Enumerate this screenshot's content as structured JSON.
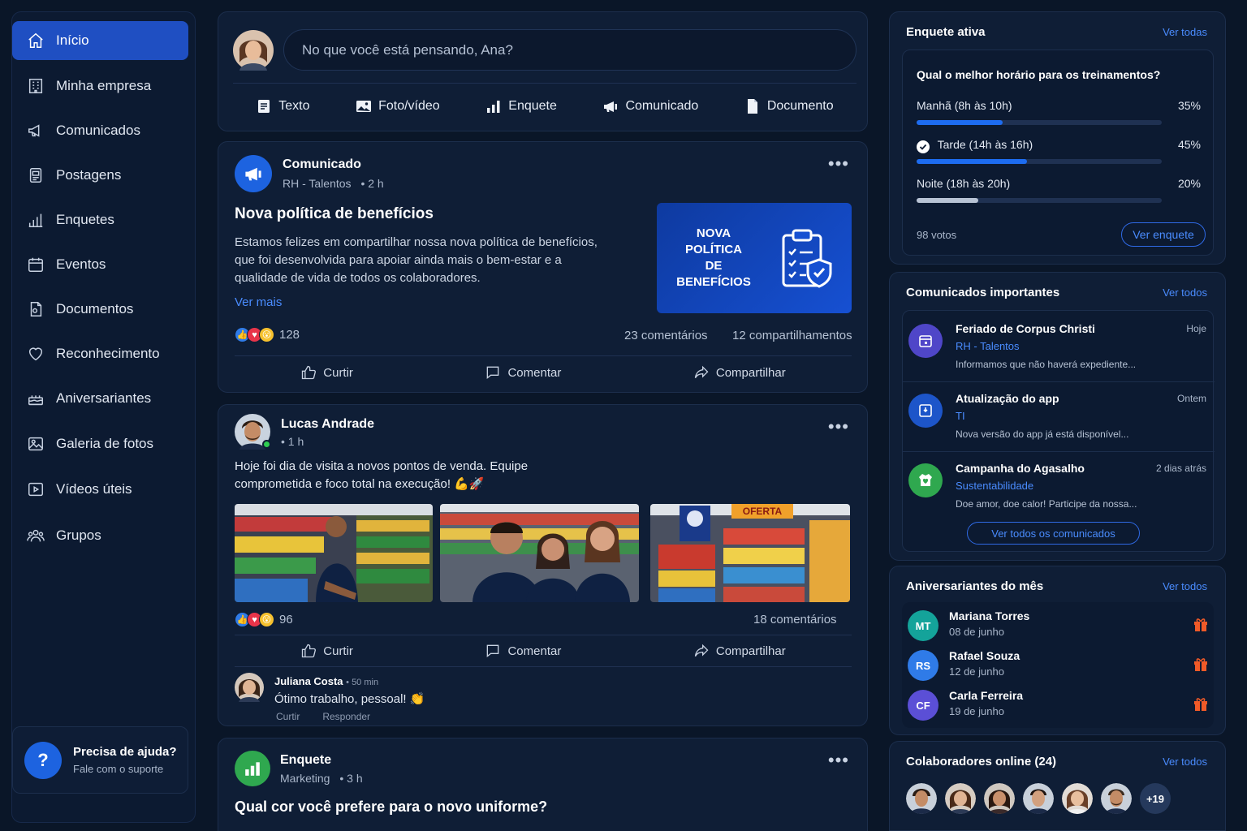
{
  "sidebar": {
    "items": [
      {
        "label": "Início",
        "icon": "home-icon",
        "active": true
      },
      {
        "label": "Minha empresa",
        "icon": "building-icon"
      },
      {
        "label": "Comunicados",
        "icon": "megaphone-icon"
      },
      {
        "label": "Postagens",
        "icon": "post-icon"
      },
      {
        "label": "Enquetes",
        "icon": "poll-icon"
      },
      {
        "label": "Eventos",
        "icon": "calendar-icon"
      },
      {
        "label": "Documentos",
        "icon": "document-icon"
      },
      {
        "label": "Reconhecimento",
        "icon": "heart-icon"
      },
      {
        "label": "Aniversariantes",
        "icon": "cake-icon"
      },
      {
        "label": "Galeria de fotos",
        "icon": "image-icon"
      },
      {
        "label": "Vídeos úteis",
        "icon": "video-icon"
      },
      {
        "label": "Grupos",
        "icon": "users-icon"
      }
    ],
    "help": {
      "title": "Precisa de ajuda?",
      "subtitle": "Fale com o suporte"
    }
  },
  "composer": {
    "placeholder": "No que você está pensando, Ana?",
    "actions": [
      {
        "label": "Texto",
        "icon": "text-icon"
      },
      {
        "label": "Foto/vídeo",
        "icon": "photo-icon"
      },
      {
        "label": "Enquete",
        "icon": "poll-icon"
      },
      {
        "label": "Comunicado",
        "icon": "megaphone-icon"
      },
      {
        "label": "Documento",
        "icon": "document-icon"
      }
    ]
  },
  "post1": {
    "author": "Comunicado",
    "dept": "RH - Talentos",
    "time": "• 2 h",
    "title": "Nova política de benefícios",
    "body": "Estamos felizes em compartilhar nossa nova política de benefícios, que foi desenvolvida para apoiar ainda mais o bem-estar e a qualidade de vida de todos os colaboradores.",
    "link": "Ver mais",
    "banner": "NOVA POLÍTICA DE BENEFÍCIOS",
    "reactions": "128",
    "comments": "23 comentários",
    "shares": "12 compartilhamentos",
    "like": "Curtir",
    "comment": "Comentar",
    "share": "Compartilhar"
  },
  "post2": {
    "author": "Lucas Andrade",
    "time": "• 1 h",
    "body": "Hoje foi dia de visita a novos pontos de venda. Equipe comprometida e foco total na execução! 💪🚀",
    "photo3_sign": "OFERTA",
    "reactions": "96",
    "comments": "18 comentários",
    "like": "Curtir",
    "comment": "Comentar",
    "share": "Compartilhar",
    "reply": {
      "name": "Juliana Costa",
      "time": "• 50 min",
      "text": "Ótimo trabalho, pessoal! 👏",
      "like": "Curtir",
      "respond": "Responder"
    }
  },
  "post3": {
    "author": "Enquete",
    "dept": "Marketing",
    "time": "• 3 h",
    "title": "Qual cor você prefere para o novo uniforme?"
  },
  "poll": {
    "header": "Enquete ativa",
    "link": "Ver todas",
    "question": "Qual o melhor horário para os treinamentos?",
    "options": [
      {
        "label": "Manhã (8h às 10h)",
        "pct": "35%",
        "value": 0.35,
        "color": "#1d6cf0"
      },
      {
        "label": "Tarde (14h às 16h)",
        "pct": "45%",
        "value": 0.45,
        "color": "#1d6cf0",
        "selected": true
      },
      {
        "label": "Noite (18h às 20h)",
        "pct": "20%",
        "value": 0.25,
        "color": "#b8c3d4"
      }
    ],
    "votes": "98 votos",
    "button": "Ver enquete"
  },
  "announcements": {
    "header": "Comunicados importantes",
    "link": "Ver todos",
    "items": [
      {
        "title": "Feriado de Corpus Christi",
        "date": "Hoje",
        "dept": "RH - Talentos",
        "snippet": "Informamos que não haverá expediente...",
        "color": "#4f46c8",
        "icon": "calendar-icon"
      },
      {
        "title": "Atualização do app",
        "date": "Ontem",
        "dept": "TI",
        "snippet": "Nova versão do app já está disponível...",
        "color": "#1d55c9",
        "icon": "app-icon"
      },
      {
        "title": "Campanha do Agasalho",
        "date": "2 dias atrás",
        "dept": "Sustentabilidade",
        "snippet": "Doe amor, doe calor! Participe da nossa...",
        "color": "#2fa84f",
        "icon": "heart-hand-icon"
      }
    ],
    "button": "Ver todos os comunicados"
  },
  "birthdays": {
    "header": "Aniversariantes do mês",
    "link": "Ver todos",
    "items": [
      {
        "initials": "MT",
        "name": "Mariana Torres",
        "date": "08 de junho",
        "color": "#14a39a"
      },
      {
        "initials": "RS",
        "name": "Rafael Souza",
        "date": "12 de junho",
        "color": "#2f7be8"
      },
      {
        "initials": "CF",
        "name": "Carla Ferreira",
        "date": "19 de junho",
        "color": "#5b4fd6"
      }
    ]
  },
  "online": {
    "header": "Colaboradores online (24)",
    "link": "Ver todos",
    "more": "+19"
  }
}
